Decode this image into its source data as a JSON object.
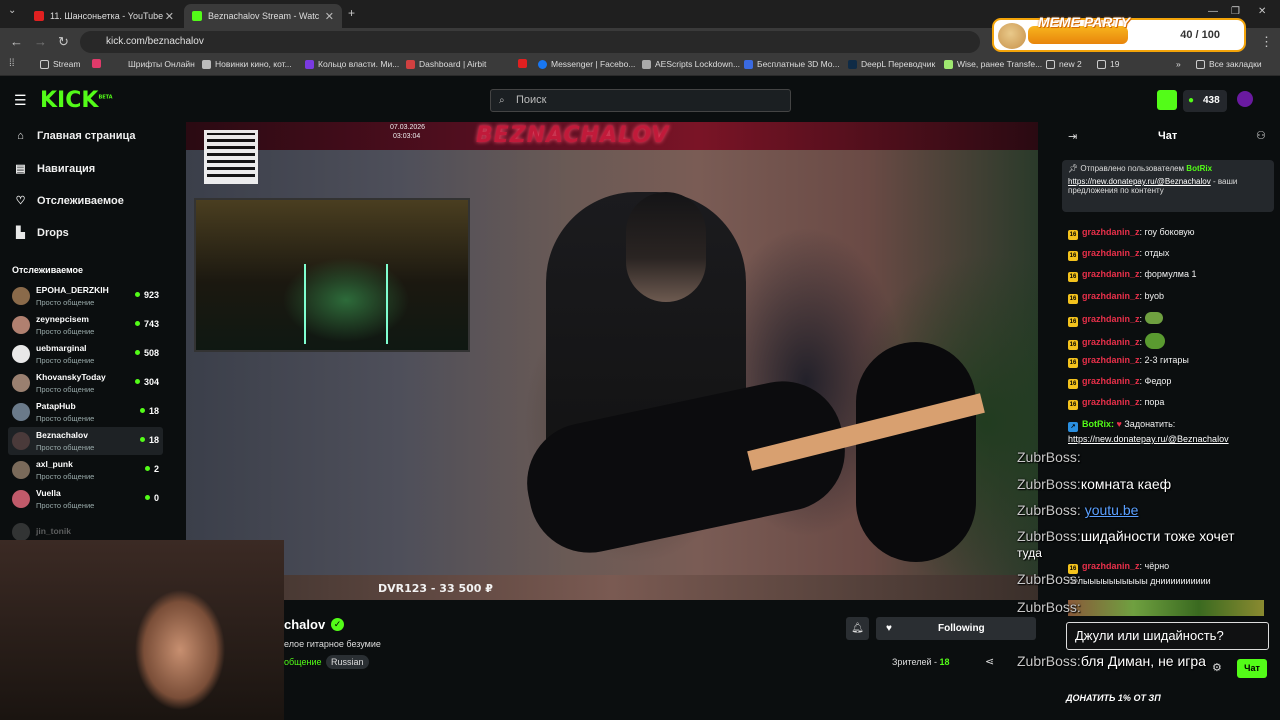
{
  "browser": {
    "tabs": [
      {
        "label": "11. Шансоньетка - YouTube",
        "active": false
      },
      {
        "label": "Beznachalov Stream - Watc",
        "active": true
      }
    ],
    "new_tab": "+",
    "url": "kick.com/beznachalov",
    "bookmarks": [
      "Stream",
      "Шрифты Онлайн",
      "Новинки кино, кот...",
      "Кольцо власти. Ми...",
      "Dashboard | Airbit",
      "Messenger | Facebo...",
      "AEScripts Lockdown...",
      "Бесплатные 3D Mo...",
      "DeepL Переводчик",
      "Wise, ранее Transfe...",
      "new 2",
      "19",
      "Все закладки"
    ],
    "meme_party": {
      "title": "MEME PARTY",
      "count": "40 / 100"
    }
  },
  "kick": {
    "logo": "KICK",
    "logo_tag": "BETA",
    "search_placeholder": "Поиск",
    "points": "438",
    "nav": [
      "Главная страница",
      "Навигация",
      "Отслеживаемое",
      "Drops"
    ],
    "following_header": "Отслеживаемое",
    "following": [
      {
        "name": "EPOHA_DERZKIH",
        "sub": "Просто общение",
        "viewers": "923",
        "color": "#8a6a4a"
      },
      {
        "name": "zeynepcisem",
        "sub": "Просто общение",
        "viewers": "743",
        "color": "#b08070"
      },
      {
        "name": "uebmarginal",
        "sub": "Просто общение",
        "viewers": "508",
        "color": "#e8e8e8"
      },
      {
        "name": "KhovanskyToday",
        "sub": "Просто общение",
        "viewers": "304",
        "color": "#9a8070"
      },
      {
        "name": "PatapHub",
        "sub": "Просто общение",
        "viewers": "18",
        "color": "#6a7a8a"
      },
      {
        "name": "Beznachalov",
        "sub": "Просто общение",
        "viewers": "18",
        "color": "#4a3a3a"
      },
      {
        "name": "axl_punk",
        "sub": "Просто общение",
        "viewers": "2",
        "color": "#7a6a5a"
      },
      {
        "name": "Vuella",
        "sub": "Просто общение",
        "viewers": "0",
        "color": "#c05a6a"
      },
      {
        "name": "jin_tonik",
        "sub": "",
        "viewers": "",
        "color": "#5a5a5a"
      }
    ]
  },
  "video": {
    "banner": "BEZNACHALOV",
    "date": "07.03.2026",
    "time": "03:03:04",
    "dvr": "DVR123 - 33 500 ₽"
  },
  "stream": {
    "channel": "chalov",
    "title": "елое гитарное безумие",
    "category": "общение",
    "language": "Russian",
    "follow_label": "Following",
    "viewers_label": "Зрителей -",
    "viewers": "18"
  },
  "chat": {
    "title": "Чат",
    "pinned_by": "Отправлено пользователем",
    "pinned_user": "BotRix",
    "pinned_link": "https://new.donatepay.ru/@Beznachalov",
    "pinned_text": "- ваши предложения по контенту",
    "messages": [
      {
        "user": "grazhdanin_z",
        "text": ": гоу боковую"
      },
      {
        "user": "grazhdanin_z",
        "text": ": отдых"
      },
      {
        "user": "grazhdanin_z",
        "text": ": формулма 1"
      },
      {
        "user": "grazhdanin_z",
        "text": ": byob"
      },
      {
        "user": "grazhdanin_z",
        "text": ":"
      },
      {
        "user": "grazhdanin_z",
        "text": ":"
      },
      {
        "user": "grazhdanin_z",
        "text": ": 2-3 гитары"
      },
      {
        "user": "grazhdanin_z",
        "text": ": Федор"
      },
      {
        "user": "grazhdanin_z",
        "text": ": пора"
      }
    ],
    "botrix_user": "BotRix:",
    "botrix_text": "Задонатить:",
    "botrix_link": "https://new.donatepay.ru/@Beznachalov",
    "tail_user": "grazhdanin_z",
    "tail_text": ": чёрно",
    "tail_text2": "белыыыыыыыыыы днииииииииии",
    "overlay": [
      {
        "name": "ZubrBoss:",
        "text": ""
      },
      {
        "name": "ZubrBoss:",
        "text": "комната каеф"
      },
      {
        "name": "ZubrBoss:",
        "text": "youtu.be"
      },
      {
        "name": "ZubrBoss:",
        "text": "шидайности тоже хочет"
      },
      {
        "name": "",
        "text": "туда"
      },
      {
        "name": "ZubrBoss:",
        "text": ""
      },
      {
        "name": "ZubrBoss:",
        "text": ""
      },
      {
        "name": "ZubrBoss:",
        "text": "бля Диман, не игра"
      }
    ],
    "input_value": "Джули или шидайность?",
    "send_label": "Чат",
    "donate_banner": "ДОНАТИТЬ 1% ОТ ЗП"
  }
}
